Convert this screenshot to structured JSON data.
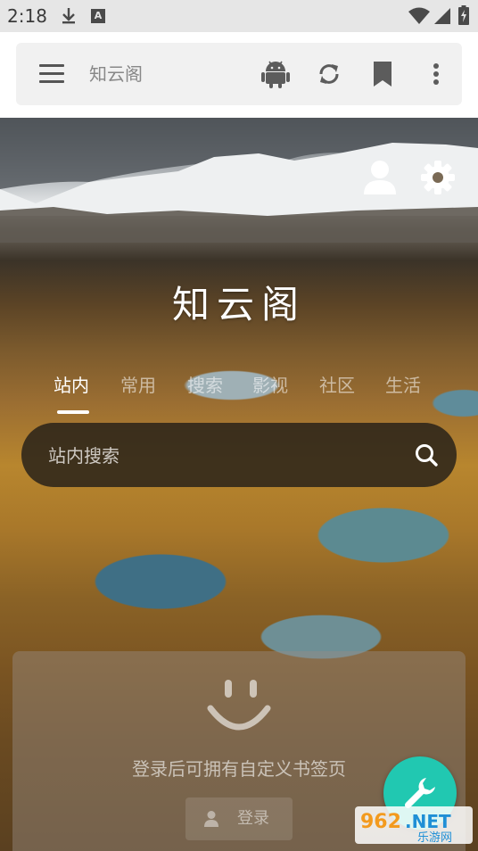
{
  "status_bar": {
    "time": "2:18",
    "indicator_letter": "A"
  },
  "app_bar": {
    "title": "知云阁",
    "icons": [
      "menu-icon",
      "android-icon",
      "refresh-icon",
      "bookmark-icon",
      "more-vert-icon"
    ]
  },
  "hero": {
    "site_title": "知云阁",
    "tabs": [
      "站内",
      "常用",
      "搜索",
      "影视",
      "社区",
      "生活"
    ],
    "active_tab": "站内"
  },
  "search": {
    "placeholder": "站内搜索",
    "value": ""
  },
  "bookmark_card": {
    "message": "登录后可拥有自定义书签页",
    "login_label": "登录"
  },
  "watermark": {
    "brand_number": "962",
    "brand_suffix": ".NET",
    "brand_text": "乐游网"
  },
  "colors": {
    "fab": "#21c8b1",
    "status_bar": "#e6e6e6",
    "app_bar": "#f1f1f1"
  }
}
